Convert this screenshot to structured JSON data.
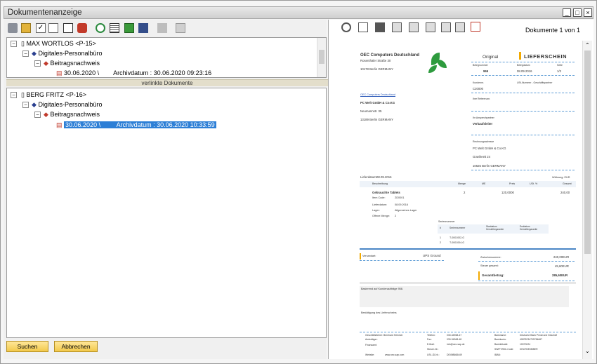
{
  "window": {
    "title": "Dokumentenanzeige"
  },
  "tree1": {
    "root": "MAX WORTLOS <P-15>",
    "child": "Digitales-Personalbüro",
    "sub": "Beitragsnachweis",
    "doc_date": "30.06.2020 \\",
    "doc_archive": "Archivdatum : 30.06.2020 09:23:16"
  },
  "splitter_label": "verlinkte Dokumente",
  "tree2": {
    "root": "BERG FRITZ <P-16>",
    "child": "Digitales-Personalbüro",
    "sub": "Beitragsnachweis",
    "doc_date": "30.06.2020 \\",
    "doc_archive": "Archivdatum : 30.06.2020 10:33:59"
  },
  "buttons": {
    "search": "Suchen",
    "cancel": "Abbrechen"
  },
  "viewer": {
    "counter": "Dokumente 1 von 1"
  },
  "doc": {
    "company": "OEC Computers Deutschland",
    "company_street": "Rosenthaler Straße 30",
    "company_city": "10178 Berlin GERMANY",
    "original": "Original",
    "type": "LIEFERSCHEIN",
    "h_belegnr": "Belegnummer",
    "h_belegdatum": "Belegdatum",
    "h_seite": "Seite",
    "v_belegnr": "965",
    "v_belegdatum": "08.09.2016",
    "v_seite": "1/2",
    "h_kundennr": "Kundennr.",
    "h_ust": "USt-Nummer - Geschäftspartner",
    "v_kundennr": "C20000",
    "link": "OEC Computers Deutschland",
    "cust_name": "PC Welt GmbH & Co.KG",
    "cust_street": "Neumannstr. 35",
    "cust_city": "13189 Berlin GERMANY",
    "ihre_ref": "Ihre Referenznr.",
    "ansprech": "Ihr Ansprechpartner",
    "ansprech_v": "Verkaufsleiter",
    "rech": "Rechnungsadresse",
    "rech1": "PC Welt GmbH & Co.KG",
    "rech2": "Gowiheeit 24",
    "rech3": "10625 Berlin GERMANY",
    "lieferdatum_l": "Lieferdatum:",
    "lieferdatum_v": "08.09.2016",
    "waehrung": "Währung: EUR",
    "col": [
      "Beschreibung",
      "Menge",
      "ME",
      "Preis",
      "USt. %",
      "Gesamt"
    ],
    "item": "Gebrauchte Tablets",
    "item_qty": "2",
    "item_price": "120,0000",
    "item_total": "240,00",
    "d1l": "Item Code:",
    "d1v": "ZD0001",
    "d2l": "Lieferdatum:",
    "d2v": "08.09.2016",
    "d3l": "Lager:",
    "d3v": "Allgemeines Lager",
    "d4l": "Offene Menge:",
    "d4v": "2",
    "serial": "Seriennummer",
    "sc": [
      "#",
      "Seriennummer",
      "Startdatum Herstellergarantie",
      "Enddatum Herstellergarantie"
    ],
    "s1": [
      "1",
      "T-0001002-G"
    ],
    "s2": [
      "2",
      "T-0001004-G"
    ],
    "versand_l": "Versandart:",
    "versand_v": "UPS Ground",
    "zw_l": "Zwischensumme:",
    "zw_v": "240,00EUR",
    "st_l": "Steuer gesamt:",
    "st_v": "45,60EUR",
    "ges_l": "Gesamtbetrag:",
    "ges_v": "285,60EUR",
    "basis": "Basierend auf Kundenaufträge 958.",
    "best": "Bestätigung des Lieferscheins",
    "f1": "Geschäftsführer: Bernhard Heinrich",
    "f2": "Amtsträger:",
    "f3": "Finanzamt:",
    "f4": "Website:",
    "f4v": "www.oec.sap.com",
    "g1": "Telefon:",
    "g2": "Fax:",
    "g3": "E-Mail:",
    "g4": "Steuer-Nr.:",
    "g5": "USt.-ID-Nr.:",
    "h1": "030-34968-47",
    "h2": "030-34968-48",
    "h3": "info@oec.sap.de",
    "h5": "DE498668449",
    "i1": "Bankname:",
    "i2": "Bankkonto:",
    "i3": "Bankleitzahl:",
    "i4": "SWIFT/BIC-Code:",
    "i5": "IBAN:",
    "j1": "Deutsche Bank Privat und Geschäf",
    "j2": "40875234709784667",
    "j3": "10070024",
    "j4": "DEUTDEDBBER"
  },
  "colors": {
    "accent": "#2d7fd6",
    "button": "#f2c94a",
    "dash": "#5b9bd5",
    "orange": "#f2a900"
  }
}
